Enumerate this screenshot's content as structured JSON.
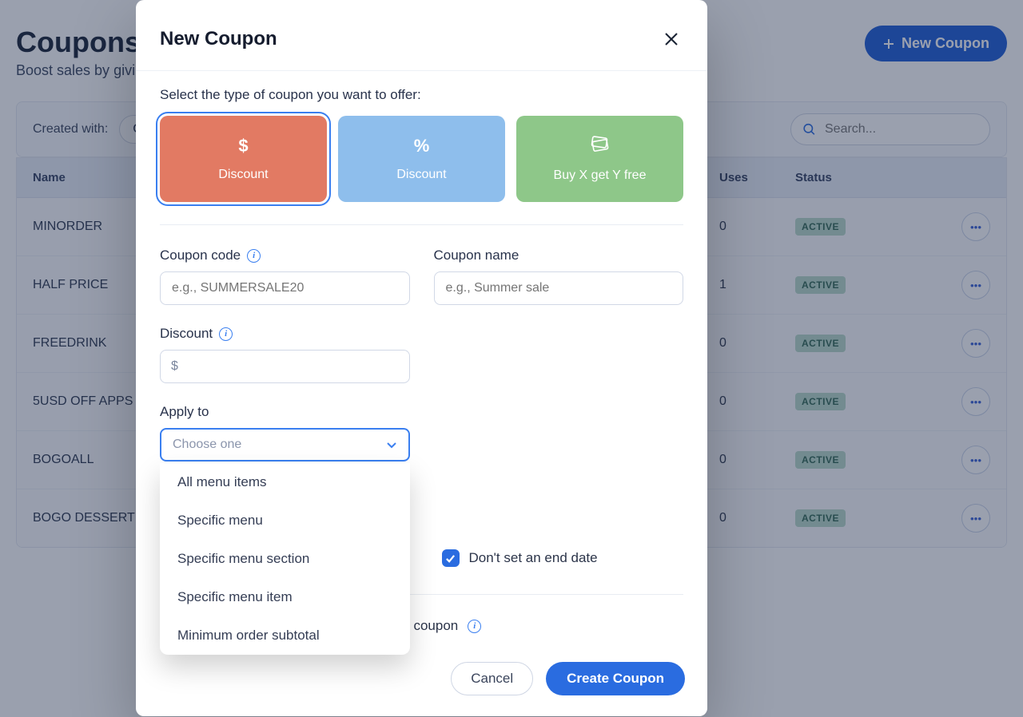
{
  "page": {
    "title": "Coupons",
    "count": "6",
    "subtitle": "Boost sales by giving",
    "new_coupon_label": "New Coupon"
  },
  "filters": {
    "created_with_label": "Created with:",
    "created_with_value": "Co",
    "search_placeholder": "Search..."
  },
  "table": {
    "headers": {
      "name": "Name",
      "uses": "Uses",
      "status": "Status"
    },
    "active_label": "ACTIVE",
    "rows": [
      {
        "name": "MINORDER",
        "uses": "0"
      },
      {
        "name": "HALF PRICE",
        "uses": "1"
      },
      {
        "name": "FREEDRINK",
        "uses": "0"
      },
      {
        "name": "5USD OFF APPS",
        "uses": "0"
      },
      {
        "name": "BOGOALL",
        "uses": "0"
      },
      {
        "name": "BOGO DESSERT",
        "uses": "0"
      }
    ]
  },
  "modal": {
    "title": "New Coupon",
    "type_prompt": "Select the type of coupon you want to offer:",
    "type_dollar": "Discount",
    "type_percent": "Discount",
    "type_bogo": "Buy X get Y free",
    "coupon_code_label": "Coupon code",
    "coupon_code_placeholder": "e.g., SUMMERSALE20",
    "coupon_name_label": "Coupon name",
    "coupon_name_placeholder": "e.g., Summer sale",
    "discount_label": "Discount",
    "currency_symbol": "$",
    "apply_to_label": "Apply to",
    "apply_to_placeholder": "Choose one",
    "apply_options": [
      "All menu items",
      "Specific menu",
      "Specific menu section",
      "Specific menu item",
      "Minimum order subtotal"
    ],
    "no_end_date_label": "Don't set an end date",
    "limit_uses_label": "Limit the total number of uses for this coupon",
    "cancel_label": "Cancel",
    "create_label": "Create Coupon"
  }
}
